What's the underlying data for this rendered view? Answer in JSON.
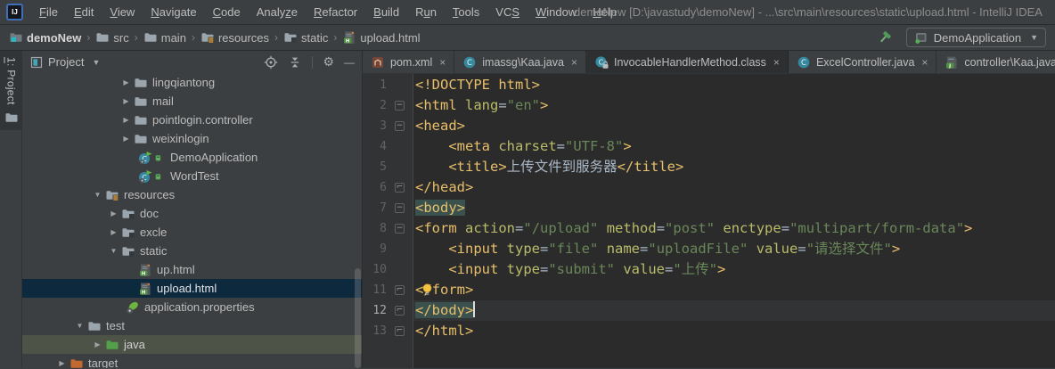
{
  "window": {
    "logo_text": "IJ",
    "title": "demoNew [D:\\javastudy\\demoNew] - ...\\src\\main\\resources\\static\\upload.html - IntelliJ IDEA"
  },
  "menu": {
    "items": [
      {
        "label": "File",
        "mnemonic_index": 0
      },
      {
        "label": "Edit",
        "mnemonic_index": 0
      },
      {
        "label": "View",
        "mnemonic_index": 0
      },
      {
        "label": "Navigate",
        "mnemonic_index": 0
      },
      {
        "label": "Code",
        "mnemonic_index": 0
      },
      {
        "label": "Analyze",
        "mnemonic_index": 5
      },
      {
        "label": "Refactor",
        "mnemonic_index": 0
      },
      {
        "label": "Build",
        "mnemonic_index": 0
      },
      {
        "label": "Run",
        "mnemonic_index": 1
      },
      {
        "label": "Tools",
        "mnemonic_index": 0
      },
      {
        "label": "VCS",
        "mnemonic_index": 2
      },
      {
        "label": "Window",
        "mnemonic_index": 0
      },
      {
        "label": "Help",
        "mnemonic_index": 0
      }
    ]
  },
  "navbar": {
    "breadcrumbs": [
      {
        "label": "demoNew",
        "icon": "project-folder",
        "bold": true
      },
      {
        "label": "src",
        "icon": "folder"
      },
      {
        "label": "main",
        "icon": "folder"
      },
      {
        "label": "resources",
        "icon": "resources-folder"
      },
      {
        "label": "static",
        "icon": "folder-badge"
      },
      {
        "label": "upload.html",
        "icon": "html-file"
      }
    ],
    "run_config": {
      "label": "DemoApplication",
      "icon": "app",
      "dropdown": "▼"
    }
  },
  "stripe": {
    "label": "1: Project",
    "mnemonic_index": 0,
    "icon": "folder"
  },
  "project": {
    "header": {
      "title": "Project",
      "dropdown": "▼",
      "actions": [
        "target",
        "collapse",
        "gear",
        "minus"
      ]
    },
    "tree": [
      {
        "label": "lingqiantong",
        "icons": [
          "folder"
        ],
        "arrow": "collapsed",
        "pad": 110
      },
      {
        "label": "mail",
        "icons": [
          "folder"
        ],
        "arrow": "collapsed",
        "pad": 110
      },
      {
        "label": "pointlogin.controller",
        "icons": [
          "folder"
        ],
        "arrow": "collapsed",
        "pad": 110
      },
      {
        "label": "weixinlogin",
        "icons": [
          "folder"
        ],
        "arrow": "collapsed",
        "pad": 110
      },
      {
        "label": "DemoApplication",
        "icons": [
          "class-run",
          "green-badge"
        ],
        "pad": 130
      },
      {
        "label": "WordTest",
        "icons": [
          "class-run",
          "green-badge"
        ],
        "pad": 130
      },
      {
        "label": "resources",
        "icons": [
          "resources-folder"
        ],
        "arrow": "expanded",
        "pad": 78
      },
      {
        "label": "doc",
        "icons": [
          "folder-badge"
        ],
        "arrow": "collapsed",
        "pad": 96
      },
      {
        "label": "excle",
        "icons": [
          "folder-badge"
        ],
        "arrow": "collapsed",
        "pad": 96
      },
      {
        "label": "static",
        "icons": [
          "folder-badge"
        ],
        "arrow": "expanded",
        "pad": 96
      },
      {
        "label": "up.html",
        "icons": [
          "html-file"
        ],
        "pad": 130
      },
      {
        "label": "upload.html",
        "icons": [
          "html-file"
        ],
        "pad": 130,
        "selected": true
      },
      {
        "label": "application.properties",
        "icons": [
          "spring-config"
        ],
        "pad": 116
      },
      {
        "label": "test",
        "icons": [
          "plain-folder"
        ],
        "arrow": "expanded",
        "pad": 58
      },
      {
        "label": "java",
        "icons": [
          "test-folder"
        ],
        "arrow": "collapsed",
        "pad": 78,
        "olive": true
      },
      {
        "label": "target",
        "icons": [
          "excluded-folder"
        ],
        "arrow": "collapsed",
        "pad": 38
      }
    ]
  },
  "editor": {
    "tabs": [
      {
        "label": "pom.xml",
        "icon": "maven-file"
      },
      {
        "label": "imassg\\Kaa.java",
        "icon": "class"
      },
      {
        "label": "InvocableHandlerMethod.class",
        "icon": "class-locked",
        "dark": true
      },
      {
        "label": "ExcelController.java",
        "icon": "class"
      },
      {
        "label": "controller\\Kaa.java",
        "icon": "java-file"
      }
    ],
    "close_glyph": "×",
    "code": {
      "lines": [
        {
          "num": 1,
          "tokens": [
            [
              "tag",
              "<!DOCTYPE html>"
            ]
          ]
        },
        {
          "num": 2,
          "fold": "start",
          "tokens": [
            [
              "tag",
              "<html"
            ],
            [
              "txt",
              " "
            ],
            [
              "attr",
              "lang"
            ],
            [
              "txt",
              "="
            ],
            [
              "str",
              "\"en\""
            ],
            [
              "tag",
              ">"
            ]
          ]
        },
        {
          "num": 3,
          "fold": "start",
          "tokens": [
            [
              "tag",
              "<head>"
            ]
          ]
        },
        {
          "num": 4,
          "indent": 4,
          "tokens": [
            [
              "tag",
              "<meta"
            ],
            [
              "txt",
              " "
            ],
            [
              "attr",
              "charset"
            ],
            [
              "txt",
              "="
            ],
            [
              "str",
              "\"UTF-8\""
            ],
            [
              "tag",
              ">"
            ]
          ]
        },
        {
          "num": 5,
          "indent": 4,
          "tokens": [
            [
              "tag",
              "<title>"
            ],
            [
              "txt",
              "上传文件到服务器"
            ],
            [
              "tag",
              "</title>"
            ]
          ]
        },
        {
          "num": 6,
          "fold": "end",
          "tokens": [
            [
              "tag",
              "</head>"
            ]
          ]
        },
        {
          "num": 7,
          "fold": "start",
          "hl": true,
          "tokens": [
            [
              "tag",
              "<body>"
            ]
          ]
        },
        {
          "num": 8,
          "fold": "start",
          "tokens": [
            [
              "tag",
              "<form"
            ],
            [
              "txt",
              " "
            ],
            [
              "attr",
              "action"
            ],
            [
              "txt",
              "="
            ],
            [
              "str",
              "\"/upload\""
            ],
            [
              "txt",
              " "
            ],
            [
              "attr",
              "method"
            ],
            [
              "txt",
              "="
            ],
            [
              "str",
              "\"post\""
            ],
            [
              "txt",
              " "
            ],
            [
              "attr",
              "enctype"
            ],
            [
              "txt",
              "="
            ],
            [
              "str",
              "\"multipart/form-data\""
            ],
            [
              "tag",
              ">"
            ]
          ]
        },
        {
          "num": 9,
          "indent": 4,
          "tokens": [
            [
              "tag",
              "<input"
            ],
            [
              "txt",
              " "
            ],
            [
              "attr",
              "type"
            ],
            [
              "txt",
              "="
            ],
            [
              "str",
              "\"file\""
            ],
            [
              "txt",
              " "
            ],
            [
              "attr",
              "name"
            ],
            [
              "txt",
              "="
            ],
            [
              "str",
              "\"uploadFile\""
            ],
            [
              "txt",
              " "
            ],
            [
              "attr",
              "value"
            ],
            [
              "txt",
              "="
            ],
            [
              "str",
              "\"请选择文件\""
            ],
            [
              "tag",
              ">"
            ]
          ]
        },
        {
          "num": 10,
          "indent": 4,
          "tokens": [
            [
              "tag",
              "<input"
            ],
            [
              "txt",
              " "
            ],
            [
              "attr",
              "type"
            ],
            [
              "txt",
              "="
            ],
            [
              "str",
              "\"submit\""
            ],
            [
              "txt",
              " "
            ],
            [
              "attr",
              "value"
            ],
            [
              "txt",
              "="
            ],
            [
              "str",
              "\"上传\""
            ],
            [
              "tag",
              ">"
            ]
          ]
        },
        {
          "num": 11,
          "fold": "end",
          "bulb": true,
          "tokens": [
            [
              "tag",
              "</form>"
            ]
          ]
        },
        {
          "num": 12,
          "fold": "end",
          "hl": true,
          "current": true,
          "caret": true,
          "tokens": [
            [
              "tag",
              "</body>"
            ]
          ]
        },
        {
          "num": 13,
          "fold": "end",
          "tokens": [
            [
              "tag",
              "</html>"
            ]
          ]
        }
      ]
    }
  },
  "colors": {
    "panel_bg": "#3C3F41",
    "editor_bg": "#2B2B2B",
    "selection_navy": "#0D293E",
    "olive_row": "#4D5347",
    "tag": "#E8BF6A",
    "attribute": "#BABC6A",
    "string": "#6A8759",
    "plain_code": "#A9B7C6",
    "matched_tag_bg": "#3B514D",
    "line_number": "#606366",
    "run_green": "#62B543",
    "spring_green": "#6DB33F",
    "test_folder_green": "#52A04A",
    "excluded_folder_orange": "#C1692E",
    "accent_teal": "#35889E",
    "bulb_yellow": "#F5C242"
  }
}
